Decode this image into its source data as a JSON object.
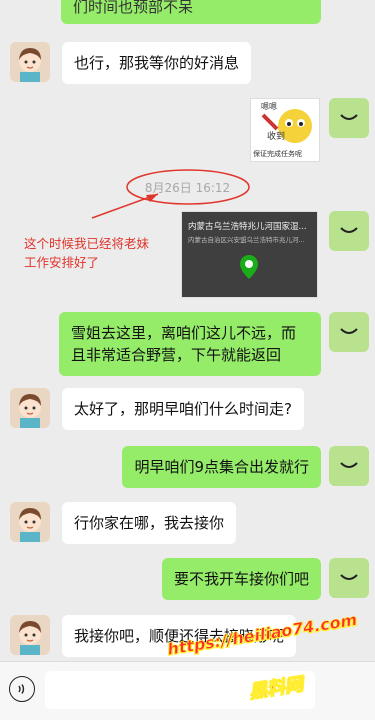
{
  "messages": {
    "top_partial": "们时间也预部不呆",
    "m1": "也行，那我等你的好消息",
    "sticker": {
      "line1": "嗯嗯",
      "line2": "收到",
      "caption": "保证完成任务呢"
    },
    "timestamp": "8月26日 16:12",
    "annotation": "这个时候我已经将老妹工作安排好了",
    "location_card": {
      "title": "内蒙古乌兰浩特兆儿河国家湿...",
      "subtitle": "内蒙古自治区兴安盟乌兰浩特市兆儿河..."
    },
    "m2": "雪姐去这里，离咱们这儿不远，而且非常适合野营，下午就能返回",
    "m3": "太好了，那明早咱们什么时间走?",
    "m4": "明早咱们9点集合出发就行",
    "m5": "行你家在哪，我去接你",
    "m6": "要不我开车接你们吧",
    "m7": "我接你吧，顺便还得去接晓彤呢"
  },
  "watermark": {
    "url": "https://heiliao74.com",
    "name": "黑料网"
  },
  "colors": {
    "sent_bubble": "#95ec69",
    "received_bubble": "#ffffff",
    "annotation": "#e0352b",
    "background": "#ececec"
  }
}
